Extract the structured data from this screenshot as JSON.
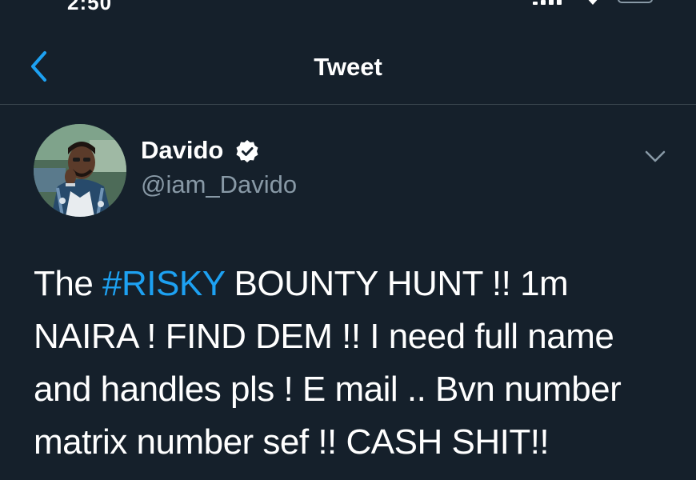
{
  "status_bar": {
    "time": "2:50"
  },
  "header": {
    "title": "Tweet"
  },
  "tweet": {
    "author_name": "Davido",
    "author_handle": "@iam_Davido",
    "text_before_hashtag": "The ",
    "hashtag": "#RISKY",
    "text_after_hashtag": "  BOUNTY HUNT !! 1m\nNAIRA ! FIND DEM !! I need full name\nand handles pls ! E mail .. Bvn number\nmatrix number sef !! CASH SHIT!!"
  },
  "icons": {
    "back": "chevron-left-icon",
    "verified": "verified-badge-icon",
    "more": "chevron-down-icon"
  },
  "colors": {
    "background": "#15202b",
    "accent": "#1da1f2",
    "secondary_text": "#8899a6",
    "divider": "#38444d"
  }
}
